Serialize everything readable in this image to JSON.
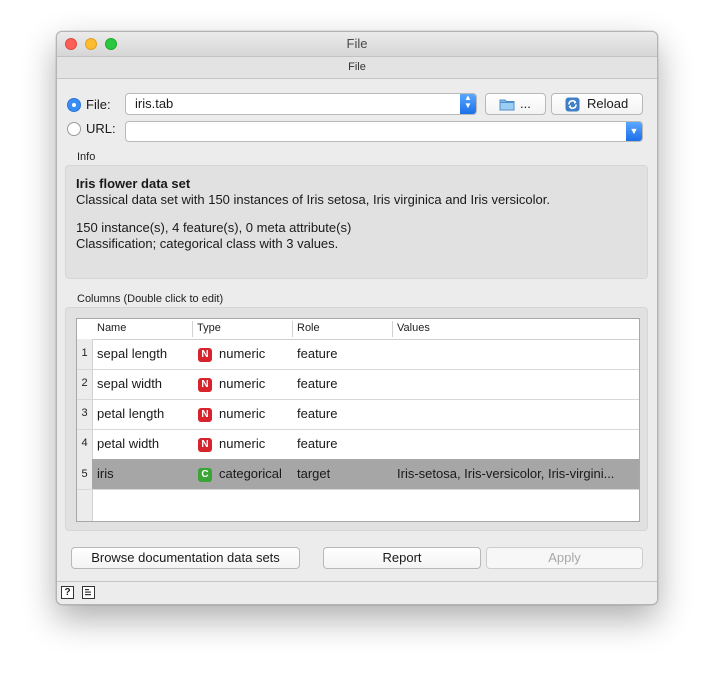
{
  "window": {
    "title": "File",
    "subtitle": "File"
  },
  "source": {
    "file_label": "File:",
    "file_value": "iris.tab",
    "browse_label": "...",
    "reload_label": "Reload",
    "url_label": "URL:",
    "url_value": ""
  },
  "info": {
    "section_label": "Info",
    "title": "Iris flower data set",
    "description": "Classical data set with 150 instances of Iris setosa, Iris virginica and Iris versicolor.",
    "summary": "150 instance(s), 4 feature(s), 0 meta attribute(s)",
    "target": "Classification; categorical class with 3 values."
  },
  "columns": {
    "section_label": "Columns (Double click to edit)",
    "headers": {
      "name": "Name",
      "type": "Type",
      "role": "Role",
      "values": "Values"
    },
    "rows": [
      {
        "num": "1",
        "name": "sepal length",
        "type_badge": "N",
        "type": "numeric",
        "role": "feature",
        "values": ""
      },
      {
        "num": "2",
        "name": "sepal width",
        "type_badge": "N",
        "type": "numeric",
        "role": "feature",
        "values": ""
      },
      {
        "num": "3",
        "name": "petal length",
        "type_badge": "N",
        "type": "numeric",
        "role": "feature",
        "values": ""
      },
      {
        "num": "4",
        "name": "petal width",
        "type_badge": "N",
        "type": "numeric",
        "role": "feature",
        "values": ""
      },
      {
        "num": "5",
        "name": "iris",
        "type_badge": "C",
        "type": "categorical",
        "role": "target",
        "values": "Iris-setosa, Iris-versicolor, Iris-virgini..."
      }
    ]
  },
  "actions": {
    "browse_docs": "Browse documentation data sets",
    "report": "Report",
    "apply": "Apply"
  },
  "status": {
    "help_icon": "?"
  },
  "colors": {
    "numeric_badge": "#d7232b",
    "categorical_badge": "#3aa436",
    "selected_row": "#a6a6a6",
    "accent": "#3a8df3"
  },
  "icons": [
    "folder-icon",
    "reload-icon",
    "help-icon",
    "report-icon"
  ]
}
